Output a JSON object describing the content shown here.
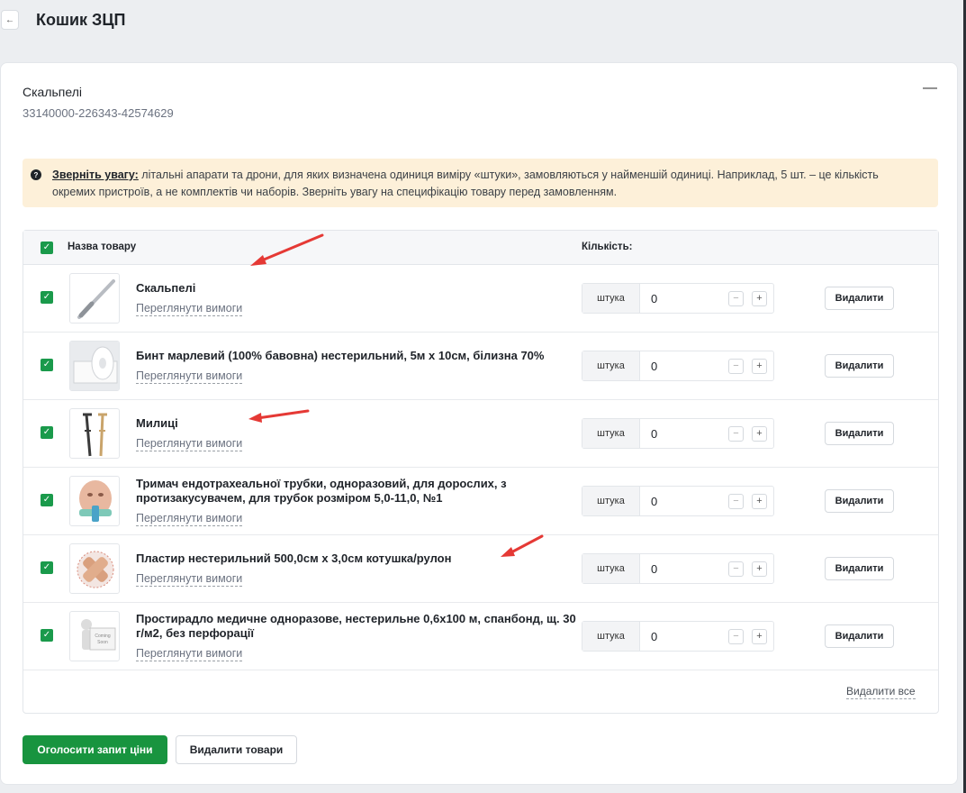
{
  "header": {
    "back_icon": "back-arrow-icon",
    "back_glyph": "←",
    "title": "Кошик ЗЦП"
  },
  "category": {
    "title": "Скальпелі",
    "code": "33140000-226343-42574629",
    "collapse_glyph": "—"
  },
  "notice": {
    "icon_glyph": "?",
    "strong": "Зверніть увагу:",
    "text": " літальні апарати та дрони, для яких визначена одиниця виміру «штуки», замовляються у найменшій одиниці. Наприклад, 5 шт. – це кількість окремих пристроїв, а не комплектів чи наборів. Зверніть увагу на специфікацію товару перед замовленням."
  },
  "table": {
    "col_name": "Назва товару",
    "col_qty": "Кількість:",
    "check_glyph": "✓",
    "items": [
      {
        "name": "Скальпелі",
        "requirements": "Переглянути вимоги",
        "unit": "штука",
        "qty": "0",
        "minus": "−",
        "plus": "+",
        "delete": "Видалити",
        "checked": true
      },
      {
        "name": "Бинт марлевий (100% бавовна) нестерильний, 5м х 10см, білизна 70%",
        "requirements": "Переглянути вимоги",
        "unit": "штука",
        "qty": "0",
        "minus": "−",
        "plus": "+",
        "delete": "Видалити",
        "checked": true
      },
      {
        "name": "Милиці",
        "requirements": "Переглянути вимоги",
        "unit": "штука",
        "qty": "0",
        "minus": "−",
        "plus": "+",
        "delete": "Видалити",
        "checked": true
      },
      {
        "name": "Тримач ендотрахеальної трубки, одноразовий, для дорослих, з протизакусувачем, для трубок розміром 5,0-11,0, №1",
        "requirements": "Переглянути вимоги",
        "unit": "штука",
        "qty": "0",
        "minus": "−",
        "plus": "+",
        "delete": "Видалити",
        "checked": true
      },
      {
        "name": "Пластир нестерильний 500,0см х 3,0см котушка/рулон",
        "requirements": "Переглянути вимоги",
        "unit": "штука",
        "qty": "0",
        "minus": "−",
        "plus": "+",
        "delete": "Видалити",
        "checked": true
      },
      {
        "name": "Простирадло медичне одноразове, нестерильне 0,6х100 м, спанбонд, щ. 30 г/м2, без перфорації",
        "requirements": "Переглянути вимоги",
        "unit": "штука",
        "qty": "0",
        "minus": "−",
        "plus": "+",
        "delete": "Видалити",
        "checked": true
      }
    ],
    "delete_all": "Видалити все"
  },
  "actions": {
    "submit": "Оголосити запит ціни",
    "remove": "Видалити товари"
  },
  "thumb_text": {
    "coming_soon_top": "Coming",
    "coming_soon_bottom": "Soon"
  },
  "colors": {
    "accent_green": "#18943f",
    "notice_bg": "#fdf0d9",
    "arrow_red": "#e53935"
  }
}
